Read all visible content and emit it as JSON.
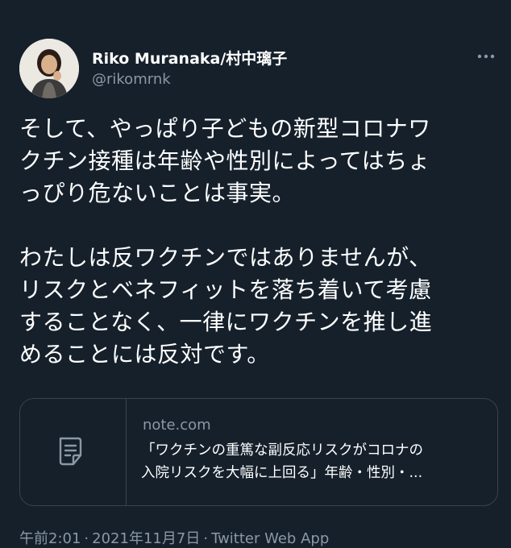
{
  "author": {
    "display_name": "Riko Muranaka/村中璃子",
    "handle": "@rikomrnk"
  },
  "tweet": {
    "paragraph1_lines": [
      "そして、やっぱり子どもの新型コロナワ",
      "クチン接種は年齢や性別によってはちょ",
      "っぴり危ないことは事実。"
    ],
    "paragraph2_lines": [
      "わたしは反ワクチンではありませんが、",
      "リスクとベネフィットを落ち着いて考慮",
      "することなく、一律にワクチンを推し進",
      "めることには反対です。"
    ]
  },
  "link_card": {
    "domain": "note.com",
    "title_line1": "「ワクチンの重篤な副反応リスクがコロナの",
    "title_line2": "入院リスクを大幅に上回る」年齢・性別・...",
    "thumb_icon": "document-icon"
  },
  "meta": {
    "time": "午前2:01",
    "separator": "·",
    "date": "2021年11月7日",
    "source": "Twitter Web App"
  },
  "colors": {
    "background": "#15202b",
    "text_primary": "#ffffff",
    "text_secondary": "#8b98a5",
    "border": "#38444d"
  }
}
